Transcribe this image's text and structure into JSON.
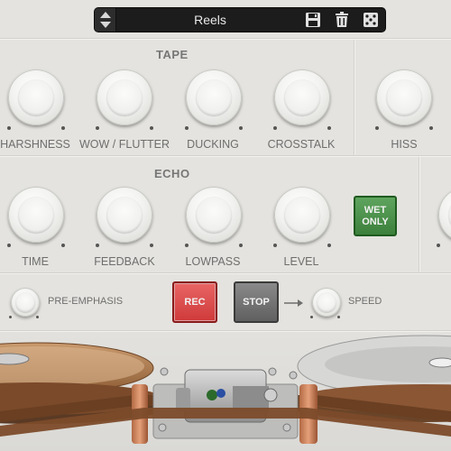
{
  "preset": {
    "name": "Reels",
    "icons": [
      "up-down-arrows-icon",
      "save-icon",
      "trash-icon",
      "dice-icon"
    ]
  },
  "tape": {
    "title": "TAPE",
    "knobs": [
      "HARSHNESS",
      "WOW / FLUTTER",
      "DUCKING",
      "CROSSTALK"
    ],
    "hiss_label": "HISS"
  },
  "echo": {
    "title": "ECHO",
    "knobs": [
      "TIME",
      "FEEDBACK",
      "LOWPASS",
      "LEVEL"
    ],
    "wet_only": "WET ONLY"
  },
  "transport": {
    "pre_emphasis": "PRE-EMPHASIS",
    "rec": "REC",
    "stop": "STOP",
    "speed": "SPEED"
  },
  "colors": {
    "rec": "#d94848",
    "stop": "#707070",
    "wet_only": "#4a8f4a",
    "tape_brown": "#7a4a2a"
  }
}
